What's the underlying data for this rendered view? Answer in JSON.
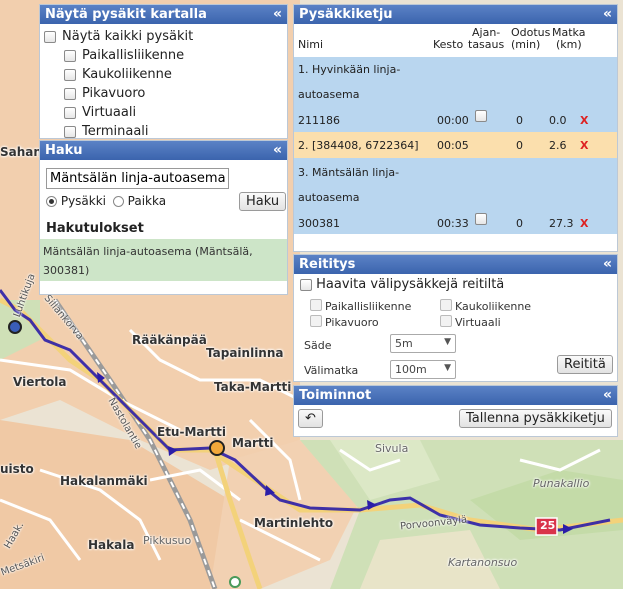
{
  "map": {
    "places": [
      "Sahan",
      "Rääkänpää",
      "Tapainlinna",
      "Taka-Martti",
      "Viertola",
      "Etu-Martti",
      "Martti",
      "uisto",
      "Hakalanmäki",
      "Martinlehto",
      "Hakala",
      "Sivula",
      "Punakallio",
      "Pikkusuo",
      "Kartanonsuo",
      "Porvoonväylä",
      "Sillankorva",
      "Metsäkiri",
      "Luhtikuja",
      "Nastolantie",
      "Haak."
    ],
    "road_badge": "25",
    "route_color": "#2b1ea8"
  },
  "stops_panel": {
    "title": "Näytä pysäkit kartalla",
    "show_all_label": "Näytä kaikki pysäkit",
    "types": [
      "Paikallisliikenne",
      "Kaukoliikenne",
      "Pikavuoro",
      "Virtuaali",
      "Terminaali"
    ]
  },
  "search_panel": {
    "title": "Haku",
    "input_value": "Mäntsälän linja-autoasema",
    "radio_stop": "Pysäkki",
    "radio_place": "Paikka",
    "search_button": "Haku",
    "results_heading": "Hakutulokset",
    "result_line1": "Mäntsälän linja-autoasema (Mäntsälä,",
    "result_line2": "300381)"
  },
  "route_panel": {
    "title": "Pysäkkiketju",
    "col_name": "Nimi",
    "col_duration": "Kesto",
    "col_timing_1": "Ajan-",
    "col_timing_2": "tasaus",
    "col_wait_1": "Odotus",
    "col_wait_2": "(min)",
    "col_dist_1": "Matka",
    "col_dist_2": "(km)",
    "stops": [
      {
        "name1": "1. Hyvinkään linja-",
        "name2": "autoasema",
        "code": "211186",
        "duration": "00:00",
        "wait": "0",
        "dist": "0.0",
        "delete": "X"
      },
      {
        "name1": "2. [384408, 6722364]",
        "duration": "00:05",
        "wait": "0",
        "dist": "2.6",
        "delete": "X"
      },
      {
        "name1": "3. Mäntsälän linja-",
        "name2": "autoasema",
        "code": "300381",
        "duration": "00:33",
        "wait": "0",
        "dist": "27.3",
        "delete": "X"
      }
    ]
  },
  "routing_panel": {
    "title": "Reititys",
    "avoid_label": "Haavita välipysäkkejä reitiltä",
    "opt_local": "Paikallisliikenne",
    "opt_long": "Kaukoliikenne",
    "opt_express": "Pikavuoro",
    "opt_virtual": "Virtuaali",
    "radius_label": "Säde",
    "radius_value": "5m",
    "interval_label": "Välimatka",
    "interval_value": "100m",
    "route_button": "Reititä"
  },
  "functions_panel": {
    "title": "Toiminnot",
    "undo_symbol": "↶",
    "save_button": "Tallenna pysäkkiketju"
  },
  "collapse_symbol": "«"
}
